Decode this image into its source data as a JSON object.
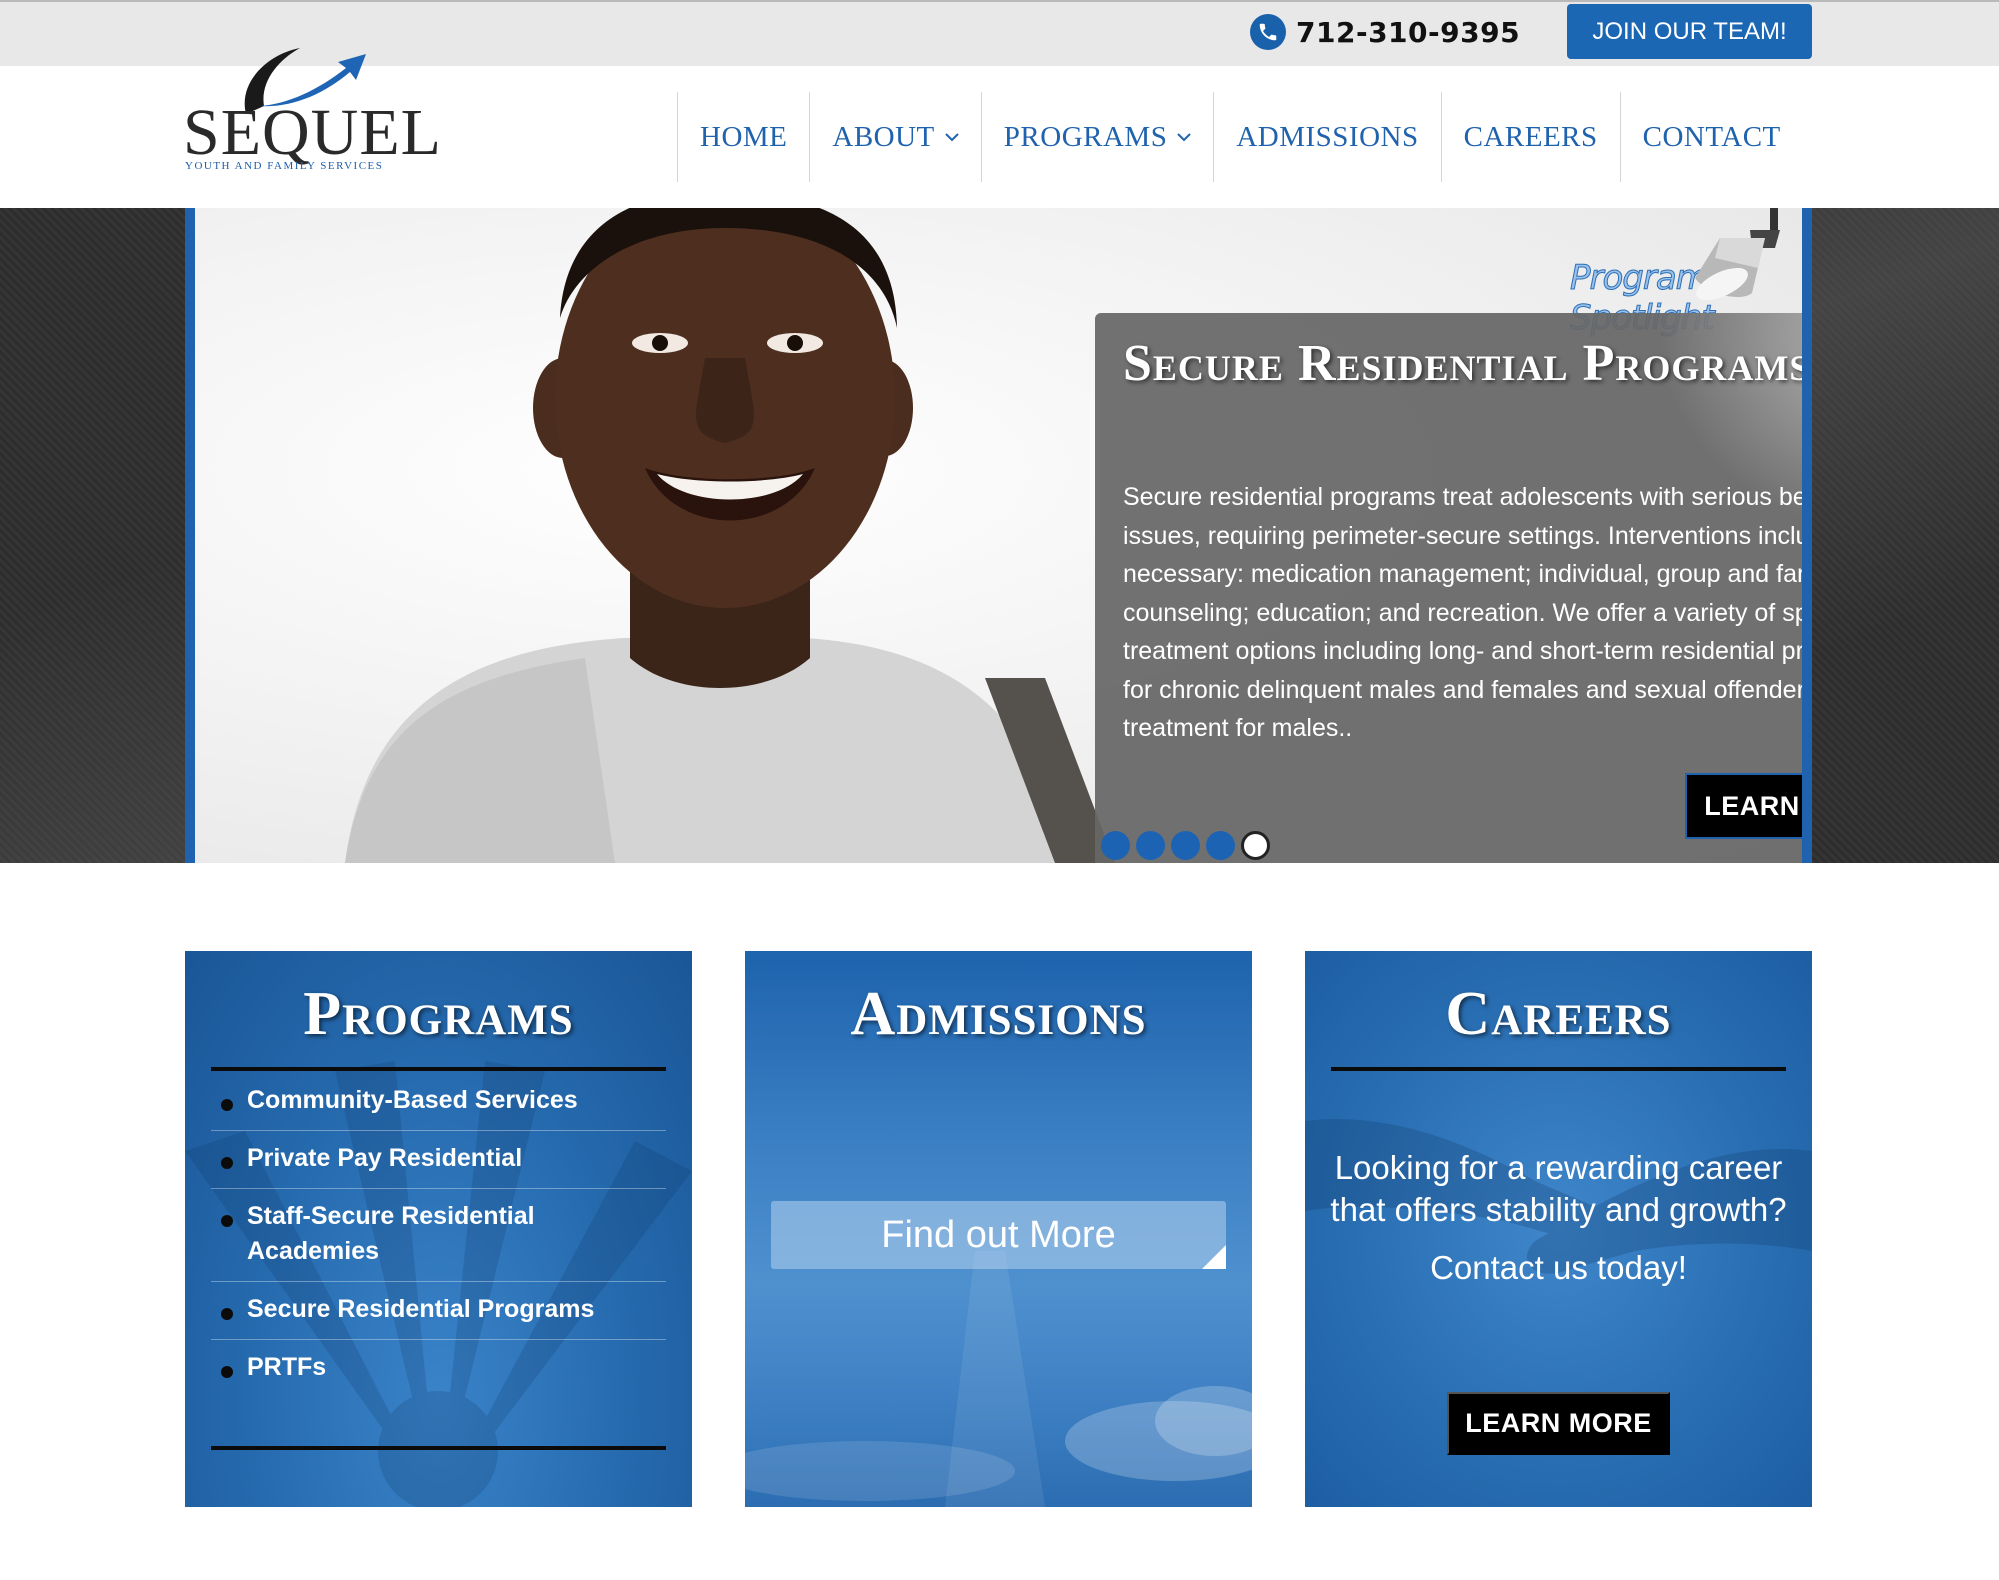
{
  "topbar": {
    "phone": "712-310-9395",
    "join_label": "JOIN OUR TEAM!"
  },
  "logo": {
    "name": "SEQUEL",
    "tagline": "YOUTH AND FAMILY SERVICES"
  },
  "nav": {
    "items": [
      {
        "label": "HOME",
        "dropdown": false
      },
      {
        "label": "ABOUT",
        "dropdown": true
      },
      {
        "label": "PROGRAMS",
        "dropdown": true
      },
      {
        "label": "ADMISSIONS",
        "dropdown": false
      },
      {
        "label": "CAREERS",
        "dropdown": false
      },
      {
        "label": "CONTACT",
        "dropdown": false
      }
    ]
  },
  "hero": {
    "spotlight_label": "Program Spotlight",
    "title": "Secure Residential Programs",
    "body": "Secure residential programs treat adolescents with serious behavioral issues, requiring perimeter-secure settings. Interventions include, when necessary: medication management; individual, group and family counseling; education; and recreation. We offer a variety of specialized treatment options including long- and short-term residential programs for chronic delinquent males and females and sexual offender treatment for males..",
    "button_label": "LEARN MORE",
    "slide_count": 5,
    "active_slide": 5
  },
  "cards": {
    "programs": {
      "title": "Programs",
      "items": [
        "Community-Based Services",
        "Private Pay Residential",
        "Staff-Secure Residential Academies",
        "Secure Residential Programs",
        "PRTFs"
      ]
    },
    "admissions": {
      "title": "Admissions",
      "button_label": "Find out More"
    },
    "careers": {
      "title": "Careers",
      "text": "Looking for a rewarding career that offers stability and growth?",
      "contact": "Contact us today!",
      "button_label": "LEARN MORE"
    }
  },
  "colors": {
    "brand_blue": "#1c67b4",
    "card_blue": "#2468ad",
    "topbar_bg": "#e8e8e8",
    "button_black": "#000000"
  },
  "icons": [
    "phone-icon",
    "chevron-down-icon",
    "lamp-icon",
    "logo-arrow-icon"
  ]
}
